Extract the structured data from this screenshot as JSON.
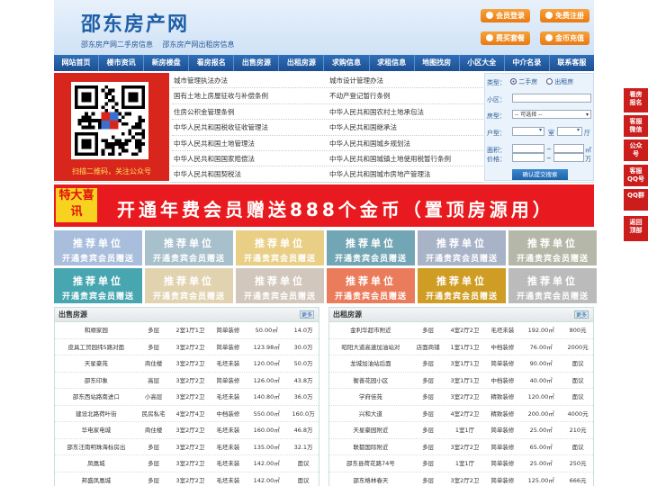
{
  "header": {
    "logo": "邵东房产网",
    "links": [
      "邵东房产网二手房信息",
      "邵东房产网出租房信息"
    ],
    "buttons": [
      "会员登录",
      "免费注册",
      "费买套餐",
      "金币充值"
    ]
  },
  "nav": [
    "网站首页",
    "楼市资讯",
    "新房楼盘",
    "看房报名",
    "出售房源",
    "出租房源",
    "求购信息",
    "求租信息",
    "地图找房",
    "小区大全",
    "中介名录",
    "联系客服"
  ],
  "qr": {
    "caption": "扫描二维码，关注公众号"
  },
  "laws": [
    [
      "城市管理执法办法",
      "城市设计管理办法"
    ],
    [
      "国有土地上房屋征收与补偿条例",
      "不动产登记暂行条例"
    ],
    [
      "住房公积金管理条例",
      "中华人民共和国农村土地承包法"
    ],
    [
      "中华人民共和国税收征收管理法",
      "中华人民共和国继承法"
    ],
    [
      "中华人民共和国土地管理法",
      "中华人民共和国城乡规划法"
    ],
    [
      "中华人民共和国国家赔偿法",
      "中华人民共和国城镇土地使用税暂行条例"
    ],
    [
      "中华人民共和国契税法",
      "中华人民共和国城市房地产管理法"
    ]
  ],
  "search": {
    "type_label": "类型：",
    "type_options": [
      "二手房",
      "出租房"
    ],
    "area_label": "小区：",
    "house_label": "房型：",
    "house_select": "-- 可选择 --",
    "huxing_label": "户型：",
    "room_unit": "室",
    "hall_unit": "厅",
    "size_label": "面积：",
    "size_unit": "㎡",
    "price_label": "价格：",
    "price_unit": "万",
    "range_sep": "~",
    "submit": "确认提交搜索"
  },
  "banner": {
    "tag": "特大喜讯",
    "text": "开通年费会员赠送888个金币（置顶房源用）"
  },
  "recommend": {
    "line1": "推荐单位",
    "line2": "开通贵宾会员赠送",
    "colors": [
      "#a9bddc",
      "#a7c0cc",
      "#e9cf86",
      "#73a6b4",
      "#a9b3c8",
      "#b5b8a8",
      "#48a6b1",
      "#e1d3b0",
      "#d2c7bc",
      "#ea7c5c",
      "#cf9c24",
      "#bbbbbb"
    ]
  },
  "sale": {
    "title": "出售房源",
    "more": "更多",
    "rows": [
      [
        "和顺家园",
        "多层",
        "2室1厅1卫",
        "简单装修",
        "50.00㎡",
        "14.0万"
      ],
      [
        "皮具工贸园纬5路对面",
        "多层",
        "3室2厅2卫",
        "简单装修",
        "123.98㎡",
        "30.0万"
      ],
      [
        "天星豪苑",
        "商住楼",
        "3室2厅2卫",
        "毛坯未装",
        "120.00㎡",
        "50.0万"
      ],
      [
        "邵东印象",
        "高层",
        "3室2厅2卫",
        "简单装修",
        "126.00㎡",
        "43.8万"
      ],
      [
        "邵东西站路南进口",
        "小高层",
        "3室2厅2卫",
        "毛坯未装",
        "140.80㎡",
        "36.0万"
      ],
      [
        "建设北路荷叶街",
        "民房私宅",
        "4室2厅4卫",
        "中档装修",
        "550.00㎡",
        "160.0万"
      ],
      [
        "华电家电城",
        "商住楼",
        "3室2厅2卫",
        "毛坯未装",
        "160.00㎡",
        "46.8万"
      ],
      [
        "邵东汪南明珠海标房出",
        "多层",
        "3室2厅2卫",
        "毛坯未装",
        "135.00㎡",
        "32.1万"
      ],
      [
        "凤凰城",
        "多层",
        "3室2厅2卫",
        "毛坯未装",
        "142.00㎡",
        "面议"
      ],
      [
        "邦盛凤凰城",
        "多层",
        "3室2厅2卫",
        "毛坯未装",
        "142.00㎡",
        "面议"
      ]
    ]
  },
  "rent": {
    "title": "出租房源",
    "more": "更多",
    "rows": [
      [
        "金利华超市附近",
        "多层",
        "4室2厅2卫",
        "毛坯未装",
        "192.00㎡",
        "800元"
      ],
      [
        "昭阳大道高速加油站对",
        "店面商铺",
        "1室1厅1卫",
        "中档装修",
        "76.00㎡",
        "2000元"
      ],
      [
        "龙城加油站后面",
        "多层",
        "3室1厅1卫",
        "简单装修",
        "90.00㎡",
        "面议"
      ],
      [
        "衡善花园小区",
        "多层",
        "3室1厅1卫",
        "中档装修",
        "40.00㎡",
        "面议"
      ],
      [
        "学府佳苑",
        "多层",
        "3室2厅2卫",
        "精致装修",
        "120.00㎡",
        "面议"
      ],
      [
        "兴和大道",
        "多层",
        "4室2厅2卫",
        "精致装修",
        "200.00㎡",
        "4000元"
      ],
      [
        "天星豪园附近",
        "多层",
        "1室1厅",
        "简单装修",
        "25.00㎡",
        "210元"
      ],
      [
        "联都国际附近",
        "多层",
        "3室2厅2卫",
        "简单装修",
        "65.00㎡",
        "面议"
      ],
      [
        "邵东县荷花路74号",
        "多层",
        "1室1厅",
        "简单装修",
        "25.00㎡",
        "250元"
      ],
      [
        "邵东格林春天",
        "多层",
        "3室2厅2卫",
        "简单装修",
        "125.00㎡",
        "666元"
      ]
    ]
  },
  "side": [
    "看房报名",
    "客服微信",
    "公众号",
    "客服QQ号",
    "QQ群",
    "返回顶部"
  ]
}
